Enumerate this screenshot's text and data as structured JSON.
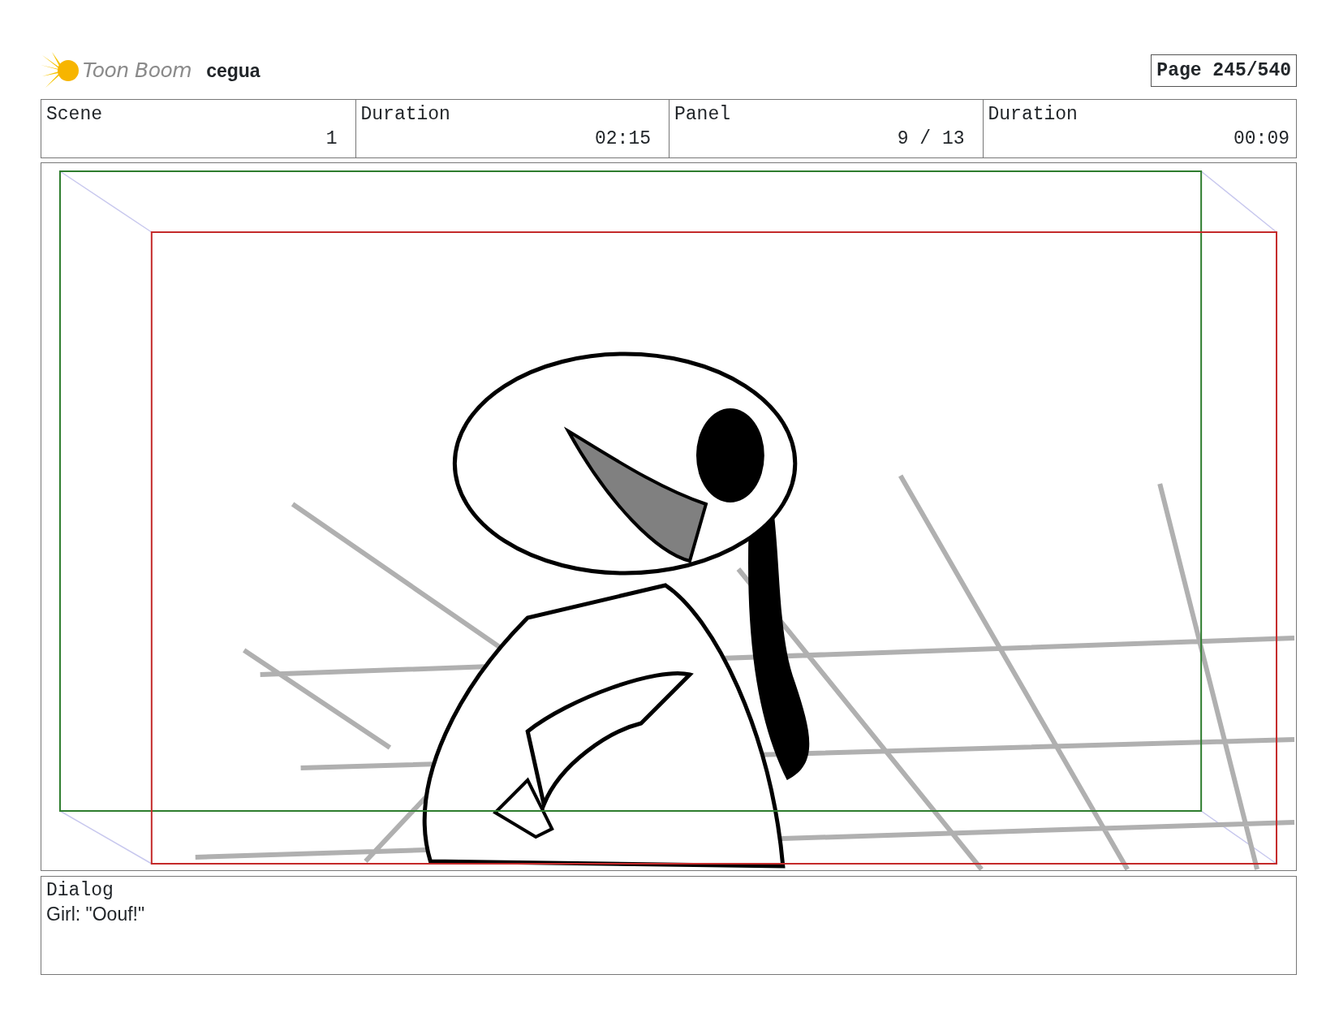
{
  "header": {
    "logo_text": "Toon Boom",
    "project": "cegua",
    "page": "Page 245/540"
  },
  "info": [
    {
      "label": "Scene",
      "value": "1"
    },
    {
      "label": "Duration",
      "value": "02:15"
    },
    {
      "label": "Panel",
      "value": "9 / 13"
    },
    {
      "label": "Duration",
      "value": "00:09"
    }
  ],
  "dialog": {
    "label": "Dialog",
    "text": "Girl: \"Oouf!\""
  }
}
